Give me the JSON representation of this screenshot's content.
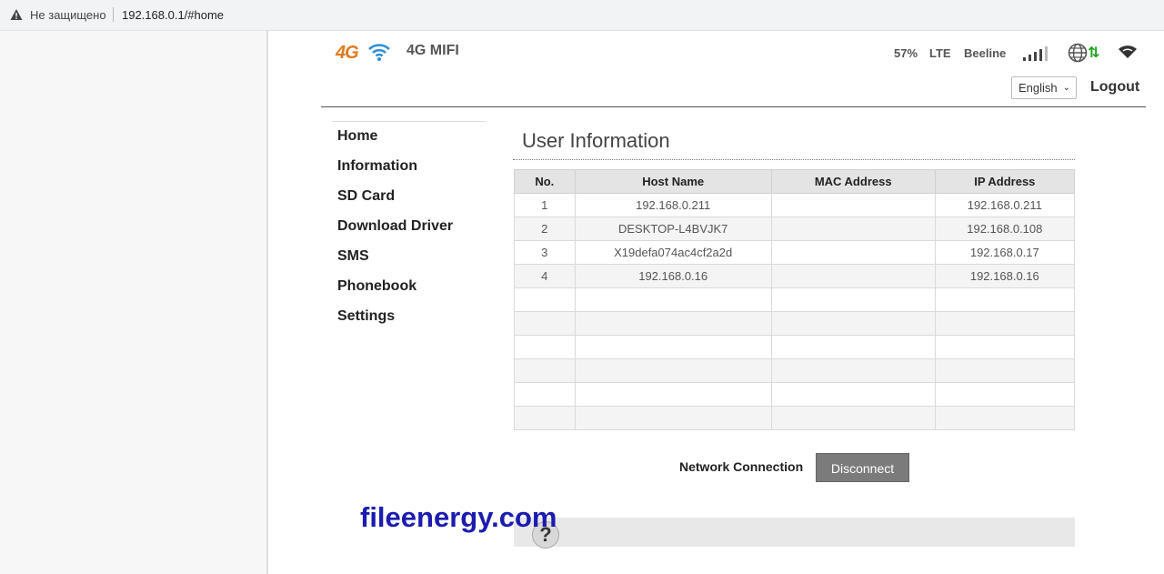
{
  "browser": {
    "security_label": "Не защищено",
    "url": "192.168.0.1/#home"
  },
  "header": {
    "logo_text": "4G",
    "product": "4G MIFI",
    "battery": "57%",
    "network_type": "LTE",
    "carrier": "Beeline",
    "language": "English",
    "logout": "Logout",
    "icons": [
      "wifi-logo-icon",
      "signal-bars-icon",
      "globe-icon",
      "data-arrows-icon",
      "wifi-status-icon"
    ],
    "arrows_glyph": "⇅",
    "colors": {
      "logo": "#e07b1c",
      "wifi": "#2f8fd8",
      "data_arrows": "#1aa31a"
    }
  },
  "nav": {
    "items": [
      "Home",
      "Information",
      "SD Card",
      "Download Driver",
      "SMS",
      "Phonebook",
      "Settings"
    ]
  },
  "main": {
    "title": "User Information",
    "table": {
      "headers": [
        "No.",
        "Host Name",
        "MAC Address",
        "IP Address"
      ],
      "rows": [
        [
          "1",
          "192.168.0.211",
          "",
          "192.168.0.211"
        ],
        [
          "2",
          "DESKTOP-L4BVJK7",
          "",
          "192.168.0.108"
        ],
        [
          "3",
          "X19defa074ac4cf2a2d",
          "",
          "192.168.0.17"
        ],
        [
          "4",
          "192.168.0.16",
          "",
          "192.168.0.16"
        ],
        [
          "",
          "",
          "",
          ""
        ],
        [
          "",
          "",
          "",
          ""
        ],
        [
          "",
          "",
          "",
          ""
        ],
        [
          "",
          "",
          "",
          ""
        ],
        [
          "",
          "",
          "",
          ""
        ],
        [
          "",
          "",
          "",
          ""
        ]
      ]
    },
    "network_connection_label": "Network Connection",
    "disconnect_button": "Disconnect",
    "help_glyph": "?"
  },
  "watermark": "fileenergy.com"
}
